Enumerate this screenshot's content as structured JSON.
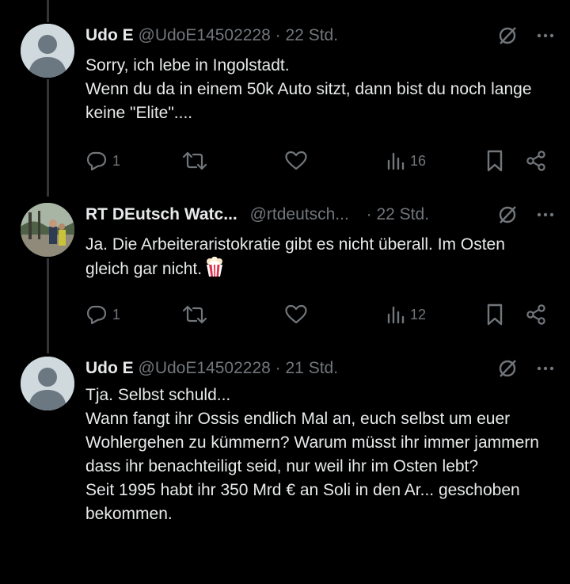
{
  "tweets": [
    {
      "name": "Udo E",
      "handle": "@UdoE14502228",
      "separator": "·",
      "time": "22 Std.",
      "text": "Sorry, ich lebe in Ingolstadt.\nWenn du da in einem 50k Auto sitzt, dann bist du noch lange keine \"Elite\"....",
      "replies": "1",
      "retweets": "",
      "likes": "",
      "views": "16"
    },
    {
      "name": "RT DEutsch Watc...",
      "handle": "@rtdeutsch...",
      "separator": "·",
      "time": "22 Std.",
      "text": "Ja. Die Arbeiteraristokratie gibt es nicht überall. Im Osten gleich gar nicht.",
      "emoji": "popcorn",
      "replies": "1",
      "retweets": "",
      "likes": "",
      "views": "12"
    },
    {
      "name": "Udo E",
      "handle": "@UdoE14502228",
      "separator": "·",
      "time": "21 Std.",
      "text": "Tja. Selbst schuld...\nWann fangt ihr Ossis endlich Mal an, euch selbst um euer Wohlergehen zu kümmern? Warum müsst ihr immer jammern dass ihr benachteiligt seid, nur weil ihr im Osten lebt?\nSeit 1995 habt ihr 350 Mrd € an Soli in den Ar... geschoben bekommen."
    }
  ],
  "colors": {
    "background": "#000000",
    "text": "#e7e9ea",
    "muted": "#71767b",
    "line": "#333639"
  }
}
